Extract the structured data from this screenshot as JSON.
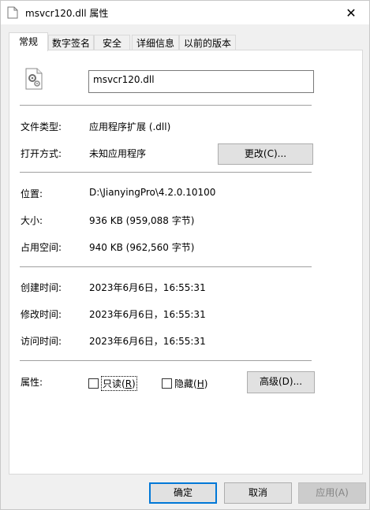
{
  "window": {
    "title": "msvcr120.dll 属性",
    "close_symbol": "✕"
  },
  "tabs": [
    {
      "label": "常规",
      "active": true
    },
    {
      "label": "数字签名",
      "active": false
    },
    {
      "label": "安全",
      "active": false
    },
    {
      "label": "详细信息",
      "active": false
    },
    {
      "label": "以前的版本",
      "active": false
    }
  ],
  "file": {
    "name": "msvcr120.dll",
    "icon": "dll-file-icon"
  },
  "type": {
    "label": "文件类型:",
    "value": "应用程序扩展 (.dll)"
  },
  "opens_with": {
    "label": "打开方式:",
    "value": "未知应用程序",
    "change_button": "更改(C)..."
  },
  "location": {
    "label": "位置:",
    "value": "D:\\JianyingPro\\4.2.0.10100"
  },
  "size": {
    "label": "大小:",
    "value": "936 KB (959,088 字节)"
  },
  "size_on_disk": {
    "label": "占用空间:",
    "value": "940 KB (962,560 字节)"
  },
  "created": {
    "label": "创建时间:",
    "value": "2023年6月6日，16:55:31"
  },
  "modified": {
    "label": "修改时间:",
    "value": "2023年6月6日，16:55:31"
  },
  "accessed": {
    "label": "访问时间:",
    "value": "2023年6月6日，16:55:31"
  },
  "attributes": {
    "label": "属性:",
    "readonly": {
      "text": "只读(",
      "key": "R",
      "end": ")",
      "checked": false
    },
    "hidden": {
      "text": "隐藏(",
      "key": "H",
      "end": ")",
      "checked": false
    },
    "advanced_button": "高级(D)..."
  },
  "buttons": {
    "ok": "确定",
    "cancel": "取消",
    "apply": "应用(A)"
  },
  "colors": {
    "accent": "#0078d7",
    "panel_bg": "#ffffff",
    "window_bg": "#f0f0f0"
  }
}
